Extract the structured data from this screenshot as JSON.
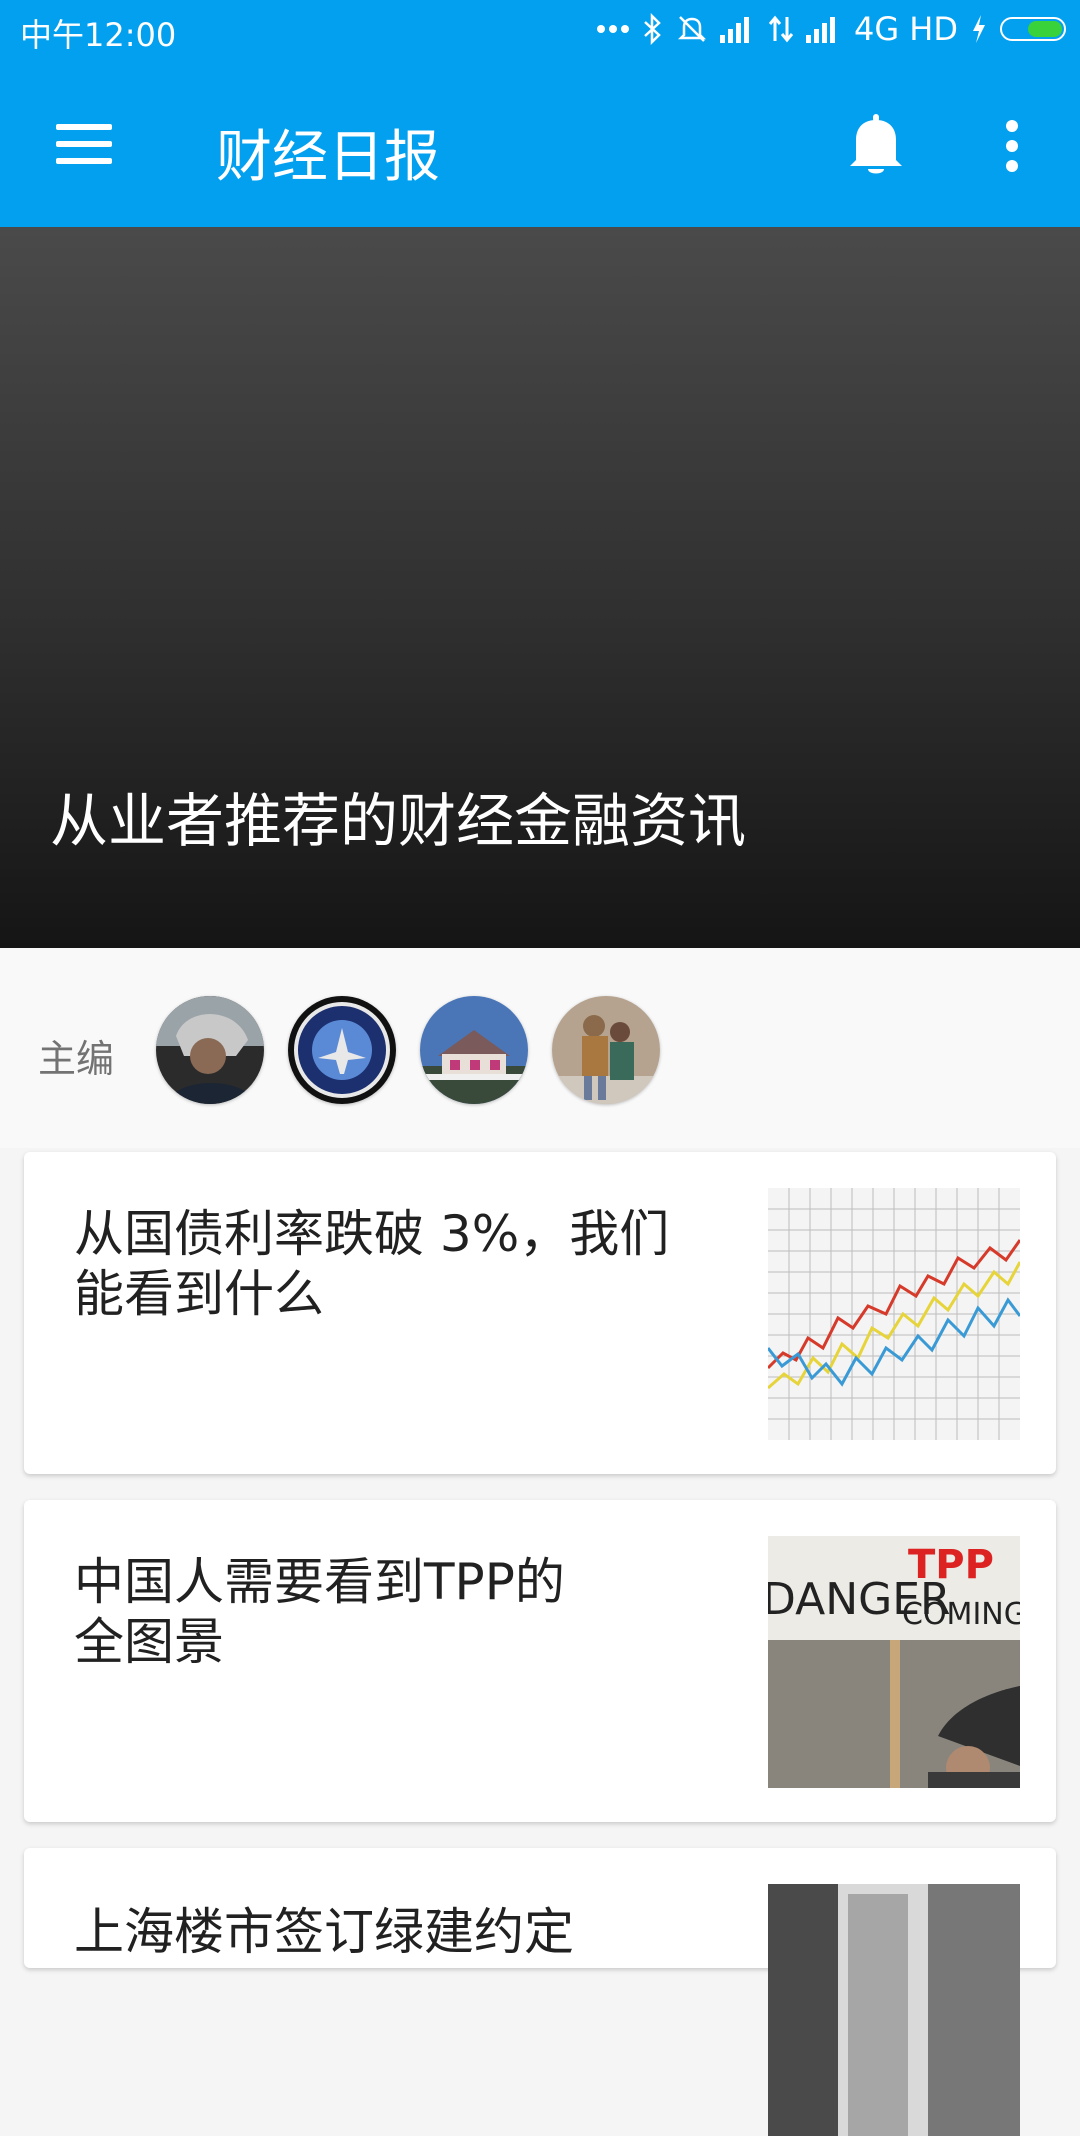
{
  "status_bar": {
    "time": "中午12:00",
    "signal_text": "4G HD",
    "icons": [
      "more-dots-icon",
      "bluetooth-icon",
      "mute-bell-icon",
      "signal-icon",
      "data-arrows-icon",
      "signal-icon",
      "charging-icon",
      "battery-icon"
    ],
    "battery_color": "#3ad23a"
  },
  "app_bar": {
    "title": "财经日报",
    "background_color": "#03a0f0",
    "icons": [
      "menu-icon",
      "notification-bell-icon",
      "more-vert-icon"
    ]
  },
  "hero": {
    "title": "从业者推荐的财经金融资讯"
  },
  "editors": {
    "label": "主编",
    "avatars": [
      "avatar-person-hood",
      "avatar-jet-badge",
      "avatar-house",
      "avatar-couple"
    ]
  },
  "articles": [
    {
      "headline_line1": "从国债利率跌破 3%，我们",
      "headline_line2": "能看到什么",
      "thumbnail": "stock-chart-image"
    },
    {
      "headline_line1": "中国人需要看到TPP的",
      "headline_line2": "全图景",
      "thumbnail": "protest-sign-image",
      "sign_text_top": "TPP",
      "sign_text_left": "DANGER",
      "sign_text_right": "COMING"
    },
    {
      "headline_line1": "上海楼市签订绿建约定",
      "thumbnail": "building-image"
    }
  ]
}
